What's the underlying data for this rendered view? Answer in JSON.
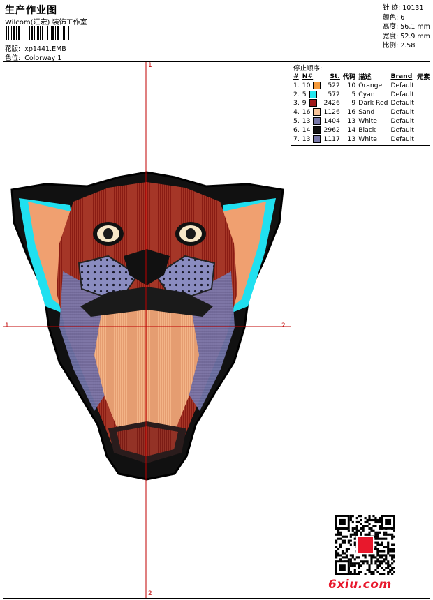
{
  "header": {
    "title": "生产作业图",
    "company": "Wilcom(汇宏) 装饰工作室",
    "design_label": "花版:",
    "design_value": "xp1441.EMB",
    "colorway_label": "色位:",
    "colorway_value": "Colorway 1"
  },
  "stats": {
    "stitches_label": "针 迹:",
    "stitches_value": "10131",
    "colors_label": "颜色:",
    "colors_value": "6",
    "height_label": "高度:",
    "height_value": "56.1 mm",
    "width_label": "宽度:",
    "width_value": "52.9 mm",
    "scale_label": "比例:",
    "scale_value": "2.58"
  },
  "stop_sequence": {
    "title": "停止顺序:",
    "columns": [
      "#",
      "N#",
      "St.",
      "代码",
      "描述",
      "Brand",
      "元素"
    ],
    "rows": [
      {
        "idx": "1.",
        "n": "10",
        "color": "#f59a3c",
        "st": "522",
        "code": "10",
        "desc": "Orange",
        "brand": "Default"
      },
      {
        "idx": "2.",
        "n": "5",
        "color": "#22e8f0",
        "st": "572",
        "code": "5",
        "desc": "Cyan",
        "brand": "Default"
      },
      {
        "idx": "3.",
        "n": "9",
        "color": "#a01818",
        "st": "2426",
        "code": "9",
        "desc": "Dark Red",
        "brand": "Default"
      },
      {
        "idx": "4.",
        "n": "16",
        "color": "#f8c49a",
        "st": "1126",
        "code": "16",
        "desc": "Sand",
        "brand": "Default"
      },
      {
        "idx": "5.",
        "n": "13",
        "color": "#7878a8",
        "st": "1404",
        "code": "13",
        "desc": "White",
        "brand": "Default"
      },
      {
        "idx": "6.",
        "n": "14",
        "color": "#111111",
        "st": "2962",
        "code": "14",
        "desc": "Black",
        "brand": "Default"
      },
      {
        "idx": "7.",
        "n": "13",
        "color": "#7878a8",
        "st": "1117",
        "code": "13",
        "desc": "White",
        "brand": "Default"
      }
    ]
  },
  "axes": {
    "top": "1",
    "left": "1",
    "right": "2",
    "bottom": "2"
  },
  "watermark": "6xiu.com",
  "colors": {
    "axis": "#c00000",
    "watermark": "#e8182c"
  }
}
